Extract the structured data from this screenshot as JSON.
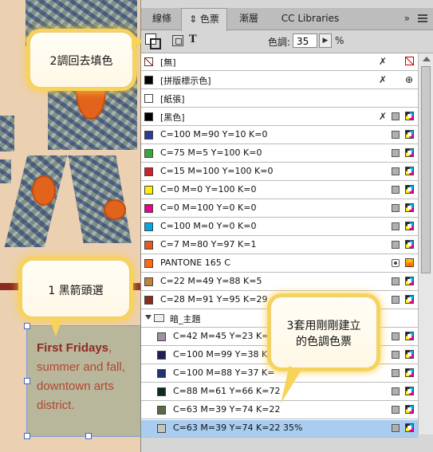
{
  "document": {
    "frame_text_bold": "First Fridays",
    "frame_text_rest": ", summer and fall, downtown arts district."
  },
  "panel": {
    "tabs": [
      {
        "label": "線條"
      },
      {
        "label": "⇕ 色票",
        "active": true
      },
      {
        "label": "漸層"
      },
      {
        "label": "CC Libraries"
      }
    ],
    "tab_overflow": "»",
    "tint_label": "色調:",
    "tint_value": "35",
    "tint_unit": "%",
    "text_button": "T",
    "swatches": [
      {
        "name": "[無]",
        "color": "none",
        "icons": [
          "noedit",
          "none"
        ]
      },
      {
        "name": "[拼版標示色]",
        "color": "#000000",
        "icons": [
          "noedit",
          "registration"
        ]
      },
      {
        "name": "[紙張]",
        "color": "#ffffff",
        "icons": []
      },
      {
        "name": "[黑色]",
        "color": "#000000",
        "icons": [
          "noedit",
          "gray",
          "cmyk"
        ]
      },
      {
        "name": "C=100 M=90 Y=10 K=0",
        "color": "#2b3d8f",
        "icons": [
          "gray",
          "cmyk"
        ]
      },
      {
        "name": "C=75 M=5 Y=100 K=0",
        "color": "#3aa63a",
        "icons": [
          "gray",
          "cmyk"
        ]
      },
      {
        "name": "C=15 M=100 Y=100 K=0",
        "color": "#d0202a",
        "icons": [
          "gray",
          "cmyk"
        ]
      },
      {
        "name": "C=0 M=0 Y=100 K=0",
        "color": "#ffef00",
        "icons": [
          "gray",
          "cmyk"
        ]
      },
      {
        "name": "C=0 M=100 Y=0 K=0",
        "color": "#ec008c",
        "icons": [
          "gray",
          "cmyk"
        ]
      },
      {
        "name": "C=100 M=0 Y=0 K=0",
        "color": "#00a9e6",
        "icons": [
          "gray",
          "cmyk"
        ]
      },
      {
        "name": "C=7 M=80 Y=97 K=1",
        "color": "#e05a26",
        "icons": [
          "gray",
          "cmyk"
        ]
      },
      {
        "name": "PANTONE 165 C",
        "color": "#ff6a13",
        "icons": [
          "spot",
          "spotcolor"
        ]
      },
      {
        "name": "C=22 M=49 Y=88 K=5",
        "color": "#c2813a",
        "icons": [
          "gray",
          "cmyk"
        ]
      },
      {
        "name": "C=28 M=91 Y=95 K=29",
        "color": "#8b2a1e",
        "icons": [
          "gray",
          "cmyk"
        ]
      }
    ],
    "group": {
      "name": "暗_主題",
      "items": [
        {
          "name": "C=42 M=45 Y=23 K=0",
          "color": "#9e8fa6"
        },
        {
          "name": "C=100 M=99 Y=38 K=",
          "color": "#1f1f55"
        },
        {
          "name": "C=100 M=88 Y=37 K=",
          "color": "#1f356b"
        },
        {
          "name": "C=88 M=61 Y=66 K=72",
          "color": "#0f2a24"
        },
        {
          "name": "C=63 M=39 Y=74 K=22",
          "color": "#5a6a46"
        },
        {
          "name": "C=63 M=39 Y=74 K=22 35%",
          "color": "#c4c7b8",
          "selected": true
        }
      ]
    }
  },
  "callouts": {
    "top": "2調回去填色",
    "bottom": "1 黑箭頭選",
    "right": "3套用剛剛建立的色調色票"
  }
}
